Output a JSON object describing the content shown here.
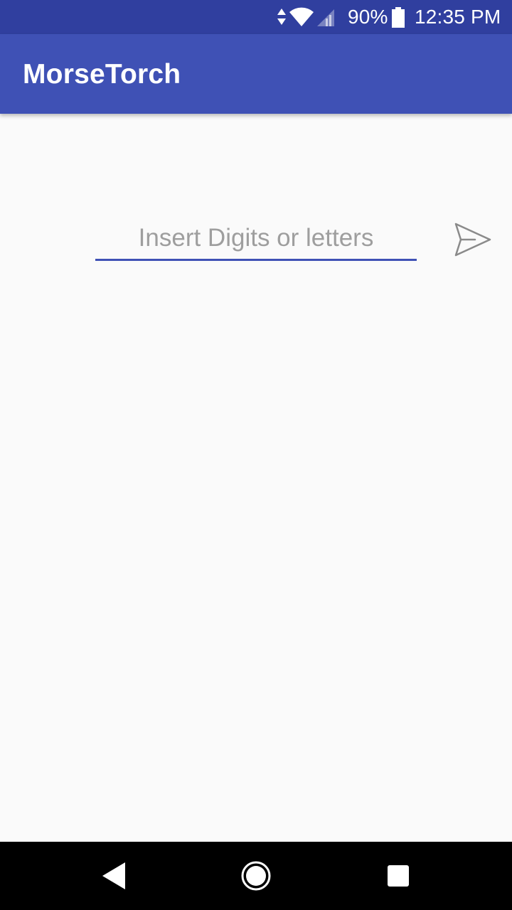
{
  "status_bar": {
    "battery_percent": "90%",
    "time": "12:35 PM",
    "icons": [
      "data-arrows-icon",
      "wifi-icon",
      "cell-signal-icon",
      "battery-icon"
    ],
    "color": "#303f9f"
  },
  "app_bar": {
    "title": "MorseTorch",
    "color": "#3f51b5"
  },
  "main": {
    "input": {
      "value": "",
      "placeholder": "Insert Digits or letters"
    },
    "send_icon": "send-icon"
  },
  "nav_bar": {
    "buttons": [
      "back-icon",
      "home-icon",
      "recents-icon"
    ]
  },
  "colors": {
    "accent": "#3f51b5",
    "background": "#fafafa",
    "placeholder": "#9e9e9e"
  }
}
